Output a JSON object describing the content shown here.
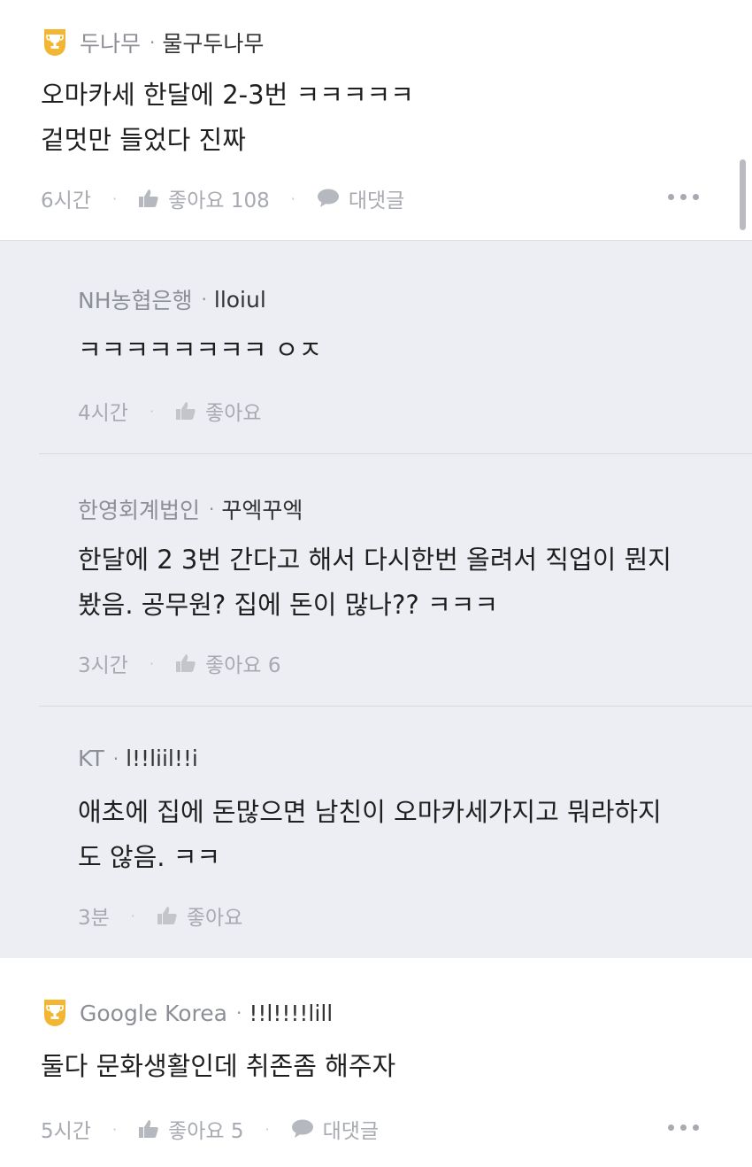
{
  "comments": [
    {
      "company": "두나무",
      "nickname": "물구두나무",
      "lines": [
        "오마카세 한달에 2-3번 ㅋㅋㅋㅋㅋ",
        "겉멋만 들었다 진짜"
      ],
      "time": "6시간",
      "like_label": "좋아요 108",
      "reply_label": "대댓글",
      "icon": "trophy-icon"
    },
    {
      "company": "Google Korea",
      "nickname": "!!l!!!!lill",
      "lines": [
        "둘다 문화생활인데 취존좀 해주자"
      ],
      "time": "5시간",
      "like_label": "좋아요 5",
      "reply_label": "대댓글",
      "icon": "trophy-icon"
    }
  ],
  "replies": [
    {
      "company": "NH농협은행",
      "nickname": "lloiul",
      "lines": [
        "ㅋㅋㅋㅋㅋㅋㅋㅋ ㅇㅈ"
      ],
      "time": "4시간",
      "like_label": "좋아요"
    },
    {
      "company": "한영회계법인",
      "nickname": "꾸엑꾸엑",
      "lines": [
        "한달에 2 3번 간다고 해서 다시한번 올려서 직업이 뭔지",
        "봤음. 공무원? 집에 돈이 많나??  ㅋㅋㅋ"
      ],
      "time": "3시간",
      "like_label": "좋아요 6"
    },
    {
      "company": "KT",
      "nickname": "l!!liil!!i",
      "lines": [
        "애초에 집에 돈많으면 남친이 오마카세가지고 뭐라하지",
        "도 않음. ㅋㅋ"
      ],
      "time": "3분",
      "like_label": "좋아요"
    }
  ],
  "separator": "·",
  "colors": {
    "trophy": "#f2b632",
    "reply_bg": "#eceef3",
    "meta": "#a7aab0"
  }
}
